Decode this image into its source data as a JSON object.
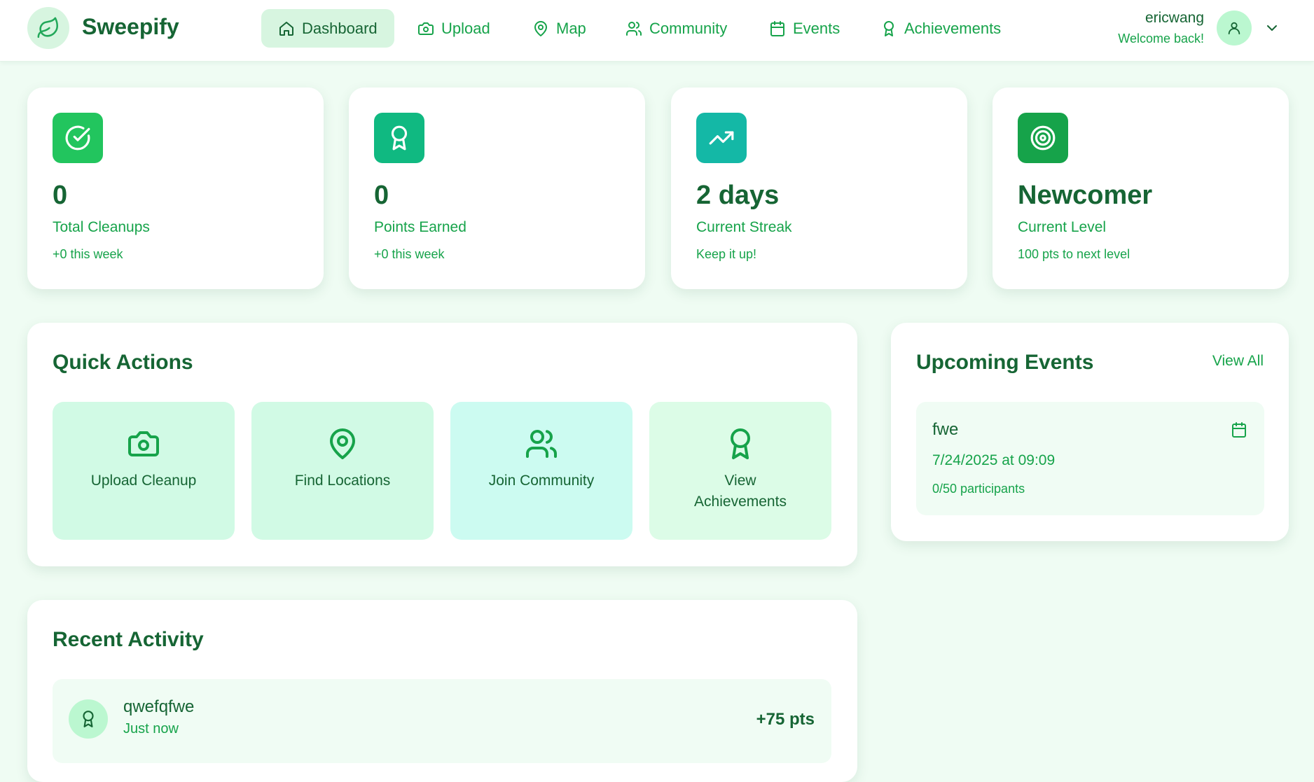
{
  "brand": {
    "name": "Sweepify",
    "icon": "leaf-icon"
  },
  "nav": [
    {
      "label": "Dashboard",
      "icon": "home-icon",
      "active": true
    },
    {
      "label": "Upload",
      "icon": "camera-icon",
      "active": false
    },
    {
      "label": "Map",
      "icon": "map-pin-icon",
      "active": false
    },
    {
      "label": "Community",
      "icon": "users-icon",
      "active": false
    },
    {
      "label": "Events",
      "icon": "calendar-icon",
      "active": false
    },
    {
      "label": "Achievements",
      "icon": "award-icon",
      "active": false
    }
  ],
  "user": {
    "name": "ericwang",
    "subtitle": "Welcome back!",
    "icon": "user-icon"
  },
  "stats": [
    {
      "value": "0",
      "label": "Total Cleanups",
      "sub": "+0 this week",
      "icon": "check-circle-icon",
      "color": "#22c55e"
    },
    {
      "value": "0",
      "label": "Points Earned",
      "sub": "+0 this week",
      "icon": "award-icon",
      "color": "#10b981"
    },
    {
      "value": "2 days",
      "label": "Current Streak",
      "sub": "Keep it up!",
      "icon": "trending-up-icon",
      "color": "#14b8a6"
    },
    {
      "value": "Newcomer",
      "label": "Current Level",
      "sub": "100 pts to next level",
      "icon": "target-icon",
      "color": "#16a34a"
    }
  ],
  "quick_actions": {
    "title": "Quick Actions",
    "items": [
      {
        "label": "Upload Cleanup",
        "icon": "camera-icon",
        "bg": "#d1fae5"
      },
      {
        "label": "Find Locations",
        "icon": "map-pin-icon",
        "bg": "#d1fae5"
      },
      {
        "label": "Join Community",
        "icon": "users-icon",
        "bg": "#ccfbf1"
      },
      {
        "label": "View Achievements",
        "icon": "award-icon",
        "bg": "#dcfce7"
      }
    ]
  },
  "upcoming_events": {
    "title": "Upcoming Events",
    "view_all": "View All",
    "events": [
      {
        "title": "fwe",
        "date": "7/24/2025 at 09:09",
        "participants": "0/50 participants",
        "icon": "calendar-icon"
      }
    ]
  },
  "recent_activity": {
    "title": "Recent Activity",
    "items": [
      {
        "title": "qwefqfwe",
        "time": "Just now",
        "points": "+75 pts",
        "icon": "award-icon"
      }
    ]
  }
}
